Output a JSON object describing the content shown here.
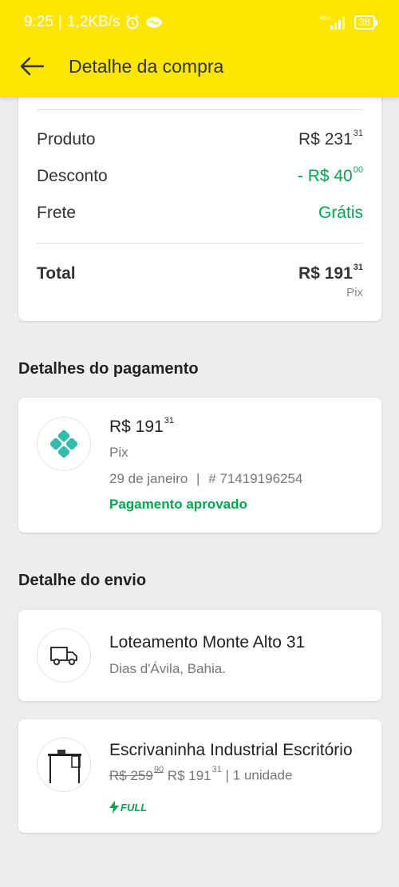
{
  "status_bar": {
    "time": "9:25",
    "speed": "1,2KB/s",
    "network": "4G+",
    "battery": "38"
  },
  "header": {
    "title": "Detalhe da compra"
  },
  "summary": {
    "product_label": "Produto",
    "product_value": "R$ 231",
    "product_cents": "31",
    "discount_label": "Desconto",
    "discount_value": "- R$ 40",
    "discount_cents": "00",
    "shipping_label": "Frete",
    "shipping_value": "Grátis",
    "total_label": "Total",
    "total_value": "R$ 191",
    "total_cents": "31",
    "total_method": "Pix"
  },
  "payment": {
    "section_title": "Detalhes do pagamento",
    "amount": "R$ 191",
    "amount_cents": "31",
    "method": "Pix",
    "date": "29 de janeiro",
    "separator": "|",
    "transaction": "# 71419196254",
    "status": "Pagamento aprovado"
  },
  "shipping": {
    "section_title": "Detalhe do envio",
    "address": "Loteamento Monte Alto 31",
    "city": "Dias d'Ávila, Bahia."
  },
  "item": {
    "title": "Escrivaninha Industrial Escritório",
    "old_price": "R$ 259",
    "old_price_cents": "90",
    "price": "R$ 191",
    "price_cents": "31",
    "quantity": "| 1 unidade",
    "badge": "FULL"
  },
  "colors": {
    "brand_yellow": "#ffe600",
    "approved_green": "#00a650",
    "pix_teal": "#32bcad"
  }
}
